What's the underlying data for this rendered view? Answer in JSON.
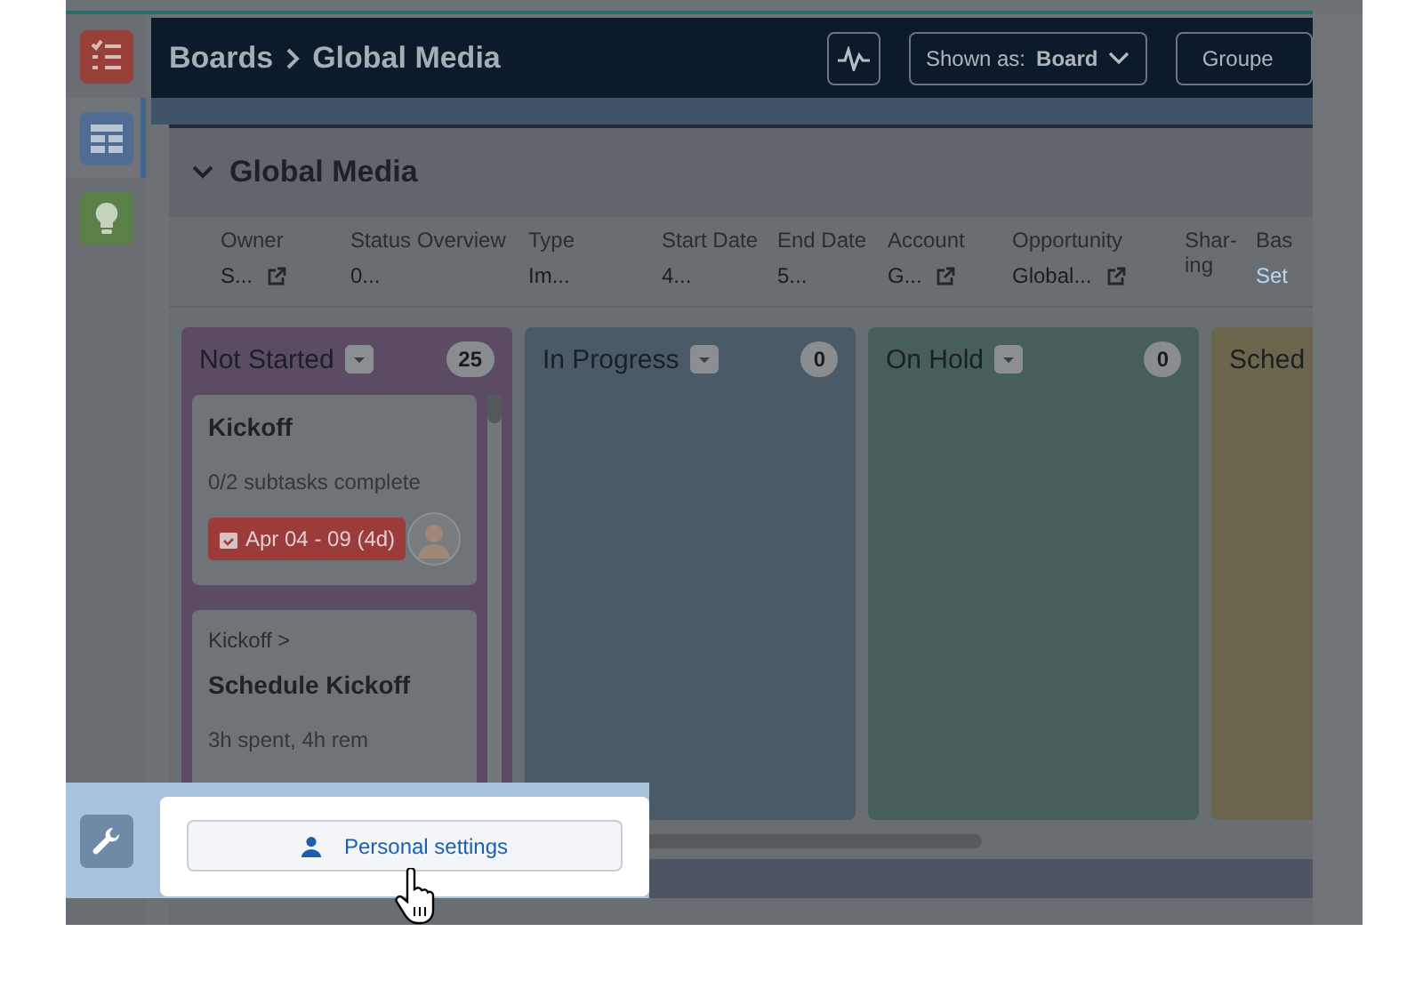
{
  "sidebar": {
    "items": [
      {
        "kind": "tasks",
        "selected": false
      },
      {
        "kind": "board",
        "selected": true
      },
      {
        "kind": "idea",
        "selected": false
      }
    ]
  },
  "header": {
    "breadcrumb": [
      "Boards",
      "Global Media"
    ],
    "view_select": {
      "label": "Shown as:",
      "value": "Board"
    },
    "group_button": "Groupe"
  },
  "board": {
    "title": "Global Media",
    "expanded": true,
    "fields": [
      {
        "label": "Owner",
        "value": "S...",
        "kind": "text",
        "link_icon": true
      },
      {
        "label": "Status Overview",
        "value": "0...",
        "kind": "text",
        "link_icon": false
      },
      {
        "label": "Type",
        "value": "Im...",
        "kind": "text",
        "link_icon": false
      },
      {
        "label": "Start Date",
        "value": "4...",
        "kind": "text",
        "link_icon": false
      },
      {
        "label": "End Date",
        "value": "5...",
        "kind": "text",
        "link_icon": false
      },
      {
        "label": "Account",
        "value": "G...",
        "kind": "text",
        "link_icon": true
      },
      {
        "label": "Opportunity",
        "value": "Global...",
        "kind": "text",
        "link_icon": true
      },
      {
        "label": "Shar-ing",
        "link_icon": false
      },
      {
        "label": "Bas",
        "value": "Set",
        "kind": "link",
        "link_icon": false
      }
    ],
    "columns": [
      {
        "name": "Not Started",
        "count": "25",
        "color": "#5b4c64",
        "cards": [
          {
            "title": "Kickoff",
            "meta": "0/2 subtasks complete",
            "due": "Apr 04 - 09 (4d)",
            "avatar": true
          },
          {
            "parent": "Kickoff >",
            "title": "Schedule Kickoff",
            "meta": "3h spent, 4h rem"
          }
        ]
      },
      {
        "name": "In Progress",
        "count": "0",
        "color": "#4a5a66"
      },
      {
        "name": "On Hold",
        "count": "0",
        "color": "#475f5b"
      },
      {
        "name": "Sched",
        "color": "#6a654b"
      }
    ]
  },
  "popover": {
    "button": "Personal settings"
  }
}
